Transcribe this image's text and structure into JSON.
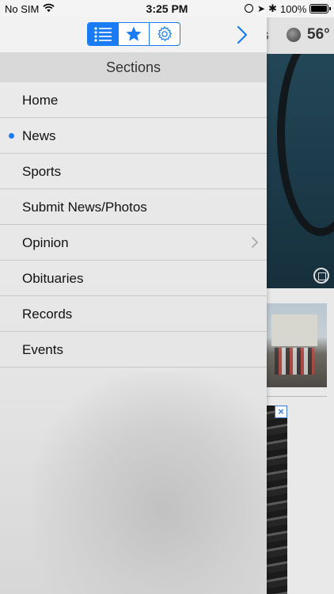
{
  "status_bar": {
    "carrier": "No SIM",
    "time": "3:25 PM",
    "battery": "100%"
  },
  "toolbar": {
    "tabs": [
      {
        "icon": "list-icon",
        "active": true
      },
      {
        "icon": "star-icon",
        "active": false
      },
      {
        "icon": "gear-icon",
        "active": false
      }
    ],
    "forward_icon": "chevron-right-icon"
  },
  "background": {
    "title_fragment": "s",
    "temperature": "56°"
  },
  "sections": {
    "title": "Sections",
    "items": [
      {
        "label": "Home",
        "selected": false,
        "has_submenu": false
      },
      {
        "label": "News",
        "selected": true,
        "has_submenu": false
      },
      {
        "label": "Sports",
        "selected": false,
        "has_submenu": false
      },
      {
        "label": "Submit News/Photos",
        "selected": false,
        "has_submenu": false
      },
      {
        "label": "Opinion",
        "selected": false,
        "has_submenu": true
      },
      {
        "label": "Obituaries",
        "selected": false,
        "has_submenu": false
      },
      {
        "label": "Records",
        "selected": false,
        "has_submenu": false
      },
      {
        "label": "Events",
        "selected": false,
        "has_submenu": false
      }
    ]
  },
  "colors": {
    "accent": "#1a7cf5",
    "header_bg": "#d9d9d9",
    "divider": "#c8c8c8"
  }
}
